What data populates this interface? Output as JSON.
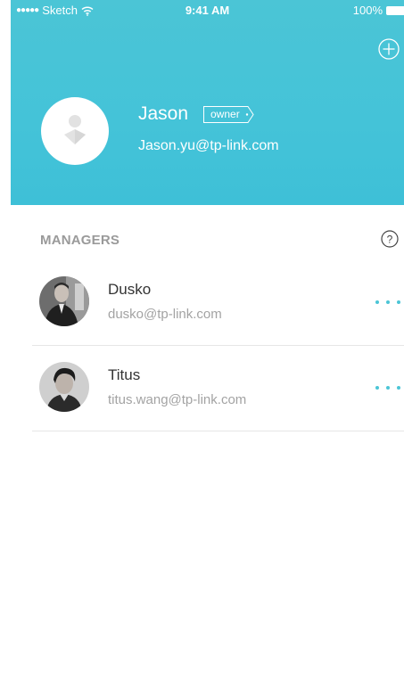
{
  "status_bar": {
    "carrier": "Sketch",
    "signal_dots": "●●●●●",
    "wifi_icon": "wifi-icon",
    "time": "9:41 AM",
    "battery": "100%",
    "battery_icon": "battery-icon"
  },
  "header": {
    "background_color": "#44c3d8",
    "add_icon": "plus-circle-icon"
  },
  "owner": {
    "name": "Jason",
    "badge": "owner",
    "email": "Jason.yu@tp-link.com",
    "avatar_icon": "user-placeholder-icon"
  },
  "managers_section": {
    "title": "MANAGERS",
    "help_icon": "question-circle-icon",
    "items": [
      {
        "name": "Dusko",
        "email": "dusko@tp-link.com",
        "more_icon": "more-dots-icon"
      },
      {
        "name": "Titus",
        "email": "titus.wang@tp-link.com",
        "more_icon": "more-dots-icon"
      }
    ]
  },
  "colors": {
    "accent": "#4bc5d6",
    "section_title": "#9a9a9a",
    "divider": "#e6e6e6"
  }
}
